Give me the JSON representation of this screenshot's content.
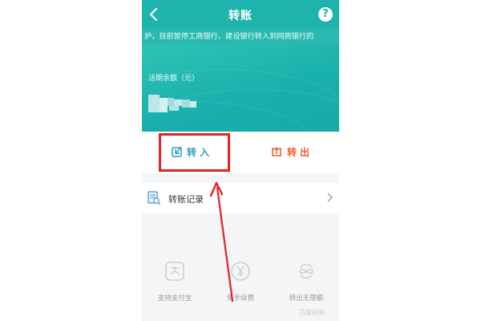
{
  "header": {
    "title": "转账",
    "help_symbol": "?"
  },
  "notice": {
    "text": "护，目前暂停工商银行、建设银行转入到网商银行的"
  },
  "balance": {
    "label": "活期余额（元）",
    "amount_state": "blurred"
  },
  "actions": {
    "transfer_in_label": "转入",
    "transfer_out_label": "转出"
  },
  "records": {
    "label": "转账记录"
  },
  "features": [
    {
      "label": "支持支付宝",
      "icon": "alipay-icon"
    },
    {
      "label": "免手续费",
      "icon": "yuan-coin-icon"
    },
    {
      "label": "转出无限额",
      "icon": "infinity-icon"
    }
  ],
  "watermark": "百度经验",
  "colors": {
    "header": "#1fb3ad",
    "transfer_in": "#2a9fc0",
    "transfer_out": "#ef5a2e",
    "annotation": "#e42024"
  }
}
